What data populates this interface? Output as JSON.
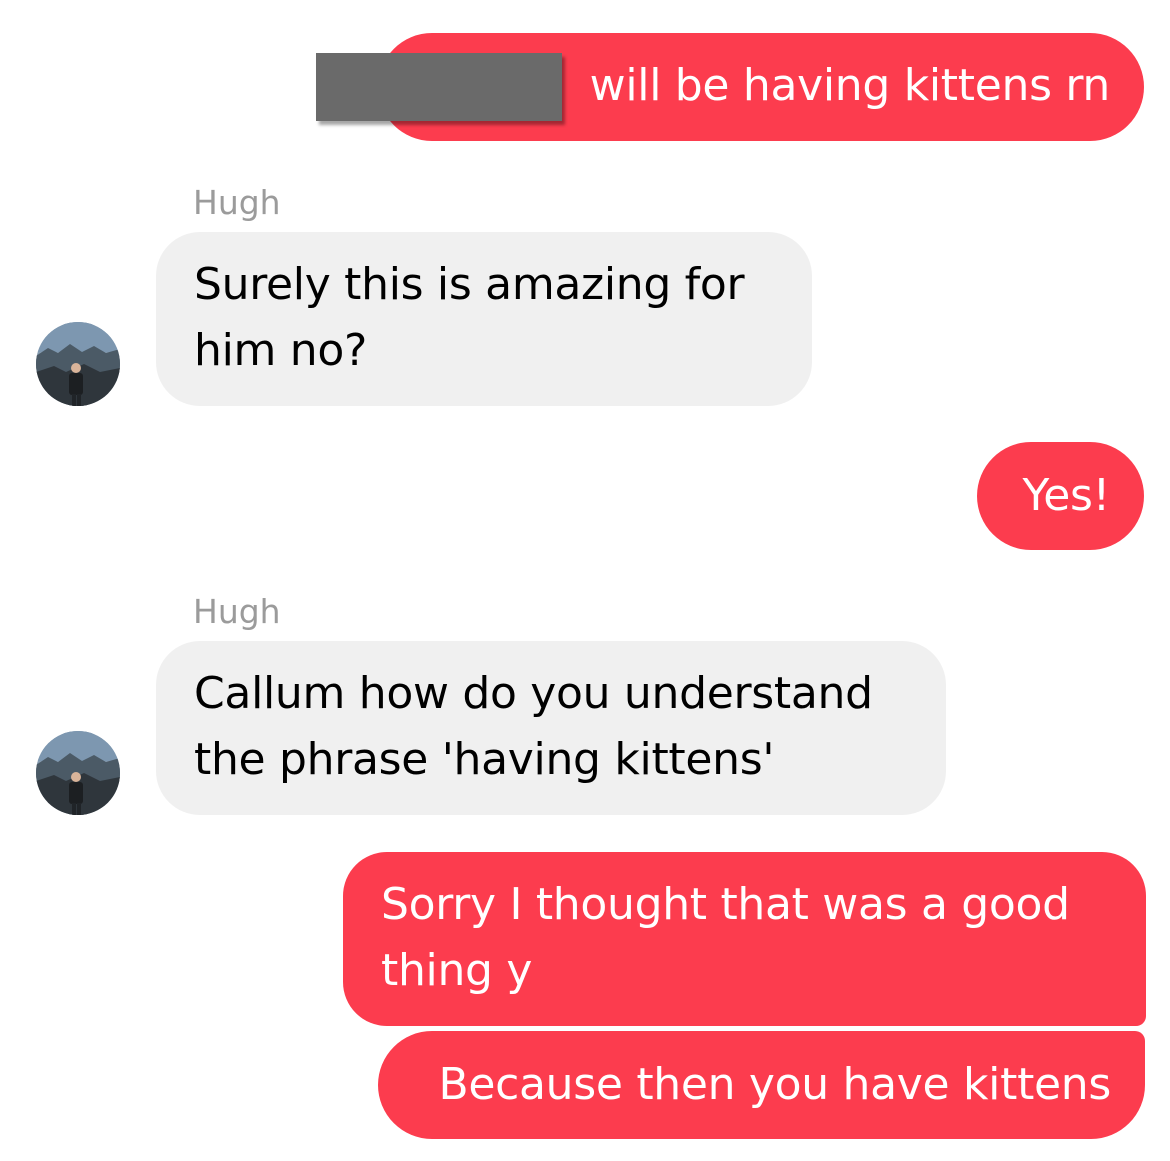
{
  "messages": [
    {
      "direction": "outgoing",
      "text": "will be having kittens rn"
    },
    {
      "direction": "incoming",
      "sender": "Hugh",
      "text": "Surely this is amazing for him no?"
    },
    {
      "direction": "outgoing",
      "text": "Yes!"
    },
    {
      "direction": "incoming",
      "sender": "Hugh",
      "text": "Callum how do you understand the phrase 'having kittens'"
    },
    {
      "direction": "outgoing",
      "text": "Sorry I thought that was a good thing y"
    },
    {
      "direction": "outgoing",
      "text": "Because then you have kittens"
    }
  ],
  "colors": {
    "outgoing_bubble": "#fc3c4e",
    "incoming_bubble": "#f0f0f0",
    "sender_name": "#9b9b9b",
    "redaction": "#6a6a6a"
  },
  "icons": {
    "avatar": "user-avatar-photo"
  }
}
